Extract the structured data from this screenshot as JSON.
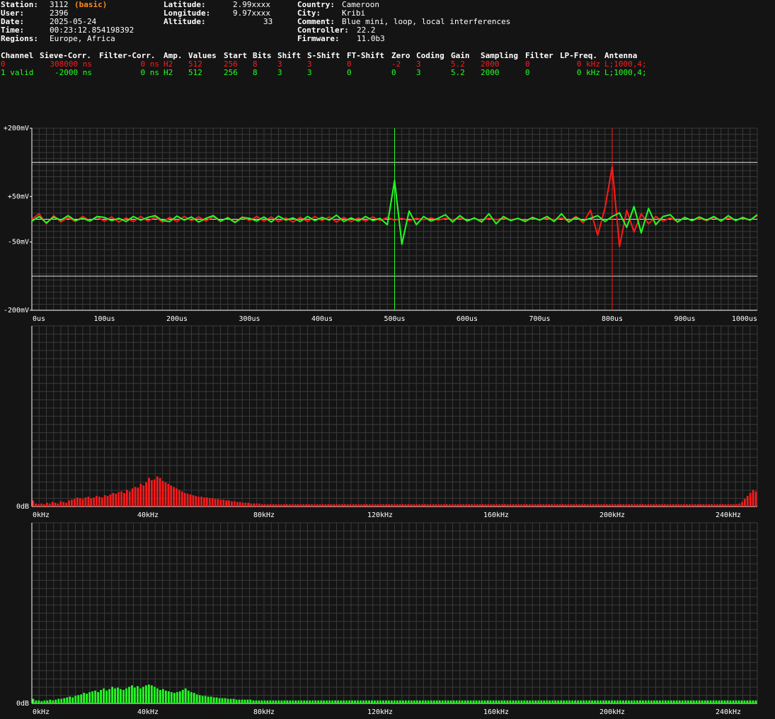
{
  "header": {
    "station_label": "Station:",
    "station": "3112",
    "station_tag": "(basic)",
    "user_label": "User:",
    "user": "2396",
    "date_label": "Date:",
    "date": "2025-05-24",
    "time_label": "Time:",
    "time": "00:23:12.854198392",
    "regions_label": "Regions:",
    "regions": "Europe, Africa",
    "lat_label": "Latitude:",
    "lat": "2.99xxxx",
    "lon_label": "Longitude:",
    "lon": "9.97xxxx",
    "alt_label": "Altitude:",
    "alt": "33",
    "country_label": "Country:",
    "country": "Cameroon",
    "city_label": "City:",
    "city": "Kribi",
    "comment_label": "Comment:",
    "comment": "Blue mini, loop, local interferences",
    "controller_label": "Controller:",
    "controller": "22.2",
    "firmware_label": "Firmware:",
    "firmware": "11.0b3"
  },
  "channel_table": {
    "headers": [
      "Channel",
      "Sieve-Corr.",
      "Filter-Corr.",
      "Amp.",
      "Values",
      "Start",
      "Bits",
      "Shift",
      "S-Shift",
      "FT-Shift",
      "Zero",
      "Coding",
      "Gain",
      "Sampling",
      "Filter",
      "LP-Freq.",
      "Antenna"
    ],
    "rows": [
      [
        "0",
        "308000 ns",
        "0 ns",
        "H2",
        "512",
        "256",
        "8",
        "3",
        "3",
        "0",
        "-2",
        "3",
        "5.2",
        "2000",
        "0",
        "0 kHz",
        "L;1000,4;"
      ],
      [
        "1 valid",
        "-2000 ns",
        "0 ns",
        "H2",
        "512",
        "256",
        "8",
        "3",
        "3",
        "0",
        "0",
        "3",
        "5.2",
        "2000",
        "0",
        "0 kHz",
        "L;1000,4;"
      ]
    ]
  },
  "colors": {
    "background": "#141414",
    "grid": "#3a3a3a",
    "axis": "#ffffff",
    "channel0": "#ff1a1a",
    "channel1": "#22ff22",
    "tag": "#ff8c1a"
  },
  "chart_data": [
    {
      "type": "line",
      "xlim": [
        0,
        1000
      ],
      "ylim": [
        -200,
        200
      ],
      "y_ticks": [
        {
          "value": 200,
          "label": "+200mV"
        },
        {
          "value": 50,
          "label": "+50mV"
        },
        {
          "value": -50,
          "label": "-50mV"
        },
        {
          "value": -200,
          "label": "-200mV"
        }
      ],
      "x_ticks": [
        {
          "value": 0,
          "label": "0us"
        },
        {
          "value": 100,
          "label": "100us"
        },
        {
          "value": 200,
          "label": "200us"
        },
        {
          "value": 300,
          "label": "300us"
        },
        {
          "value": 400,
          "label": "400us"
        },
        {
          "value": 500,
          "label": "500us"
        },
        {
          "value": 600,
          "label": "600us"
        },
        {
          "value": 700,
          "label": "700us"
        },
        {
          "value": 800,
          "label": "800us"
        },
        {
          "value": 900,
          "label": "900us"
        },
        {
          "value": 1000,
          "label": "1000us"
        }
      ],
      "threshold_lines": [
        125,
        -125,
        0
      ],
      "markers": [
        {
          "x": 500,
          "series": 1
        },
        {
          "x": 800,
          "series": 0
        }
      ],
      "series": [
        {
          "channel": "0",
          "color": "#ff1a1a",
          "x": [
            0,
            10,
            20,
            30,
            40,
            50,
            60,
            70,
            80,
            90,
            100,
            110,
            120,
            130,
            140,
            150,
            160,
            170,
            180,
            190,
            200,
            210,
            220,
            230,
            240,
            250,
            260,
            270,
            280,
            290,
            300,
            310,
            320,
            330,
            340,
            350,
            360,
            370,
            380,
            390,
            400,
            410,
            420,
            430,
            440,
            450,
            460,
            470,
            480,
            490,
            500,
            510,
            520,
            530,
            540,
            550,
            560,
            570,
            580,
            590,
            600,
            610,
            620,
            630,
            640,
            650,
            660,
            670,
            680,
            690,
            700,
            710,
            720,
            730,
            740,
            750,
            760,
            770,
            780,
            790,
            800,
            810,
            820,
            830,
            840,
            850,
            860,
            870,
            880,
            890,
            900,
            910,
            920,
            930,
            940,
            950,
            960,
            970,
            980,
            990,
            1000
          ],
          "y": [
            0,
            12,
            -10,
            8,
            -6,
            4,
            -5,
            6,
            -3,
            5,
            -4,
            5,
            -6,
            3,
            -5,
            6,
            -4,
            5,
            -6,
            4,
            -5,
            6,
            -3,
            5,
            -4,
            6,
            -5,
            4,
            -6,
            5,
            -3,
            6,
            -4,
            5,
            -5,
            3,
            -6,
            4,
            -5,
            6,
            -3,
            5,
            -6,
            4,
            -5,
            3,
            -4,
            5,
            -3,
            4,
            -2,
            2,
            -3,
            2,
            -1,
            3,
            -2,
            2,
            -1,
            2,
            -2,
            1,
            -2,
            2,
            -1,
            2,
            -1,
            1,
            -2,
            2,
            -1,
            2,
            -1,
            3,
            -4,
            6,
            -8,
            20,
            -35,
            25,
            115,
            -60,
            20,
            -28,
            12,
            -10,
            6,
            -4,
            3,
            -5,
            4,
            -3,
            2,
            -3,
            4,
            -2,
            3,
            -2,
            2,
            -2,
            8
          ]
        },
        {
          "channel": "1 valid",
          "color": "#22ff22",
          "x": [
            0,
            10,
            20,
            30,
            40,
            50,
            60,
            70,
            80,
            90,
            100,
            110,
            120,
            130,
            140,
            150,
            160,
            170,
            180,
            190,
            200,
            210,
            220,
            230,
            240,
            250,
            260,
            270,
            280,
            290,
            300,
            310,
            320,
            330,
            340,
            350,
            360,
            370,
            380,
            390,
            400,
            410,
            420,
            430,
            440,
            450,
            460,
            470,
            480,
            490,
            500,
            510,
            520,
            530,
            540,
            550,
            560,
            570,
            580,
            590,
            600,
            610,
            620,
            630,
            640,
            650,
            660,
            670,
            680,
            690,
            700,
            710,
            720,
            730,
            740,
            750,
            760,
            770,
            780,
            790,
            800,
            810,
            820,
            830,
            840,
            850,
            860,
            870,
            880,
            890,
            900,
            910,
            920,
            930,
            940,
            950,
            960,
            970,
            980,
            990,
            1000
          ],
          "y": [
            -4,
            6,
            -8,
            5,
            -2,
            8,
            -3,
            2,
            -4,
            6,
            4,
            -3,
            2,
            -5,
            6,
            -2,
            4,
            8,
            -3,
            -5,
            7,
            -2,
            5,
            -6,
            2,
            8,
            -4,
            3,
            -7,
            4,
            2,
            -4,
            5,
            -6,
            7,
            -2,
            3,
            -5,
            6,
            -3,
            4,
            -2,
            9,
            -5,
            3,
            -4,
            6,
            -3,
            2,
            -12,
            85,
            -55,
            18,
            -12,
            6,
            -4,
            2,
            10,
            -6,
            8,
            -4,
            3,
            -6,
            12,
            -10,
            6,
            -3,
            2,
            -5,
            4,
            -2,
            6,
            -5,
            12,
            -6,
            4,
            -3,
            2,
            8,
            -5,
            6,
            14,
            -18,
            28,
            -30,
            24,
            -12,
            6,
            10,
            -6,
            4,
            -3,
            5,
            -2,
            6,
            -4,
            8,
            -3,
            4,
            -2,
            10
          ]
        }
      ]
    },
    {
      "type": "bar",
      "channel": "0",
      "color": "#ff1a1a",
      "ylabel": "0dB",
      "xlim": [
        0,
        250
      ],
      "x_ticks": [
        {
          "value": 0,
          "label": "0kHz"
        },
        {
          "value": 40,
          "label": "40kHz"
        },
        {
          "value": 80,
          "label": "80kHz"
        },
        {
          "value": 120,
          "label": "120kHz"
        },
        {
          "value": 160,
          "label": "160kHz"
        },
        {
          "value": 200,
          "label": "200kHz"
        },
        {
          "value": 240,
          "label": "240kHz"
        }
      ],
      "bin_width_khz": 1.0,
      "values": [
        8,
        4,
        3,
        4,
        3,
        5,
        4,
        6,
        5,
        4,
        7,
        6,
        5,
        8,
        9,
        10,
        12,
        11,
        10,
        12,
        13,
        11,
        12,
        14,
        13,
        12,
        15,
        14,
        16,
        18,
        17,
        19,
        20,
        18,
        22,
        20,
        24,
        26,
        25,
        30,
        28,
        32,
        38,
        35,
        36,
        40,
        38,
        34,
        32,
        30,
        28,
        26,
        24,
        22,
        20,
        18,
        17,
        16,
        15,
        14,
        13,
        13,
        12,
        12,
        11,
        11,
        10,
        10,
        9,
        9,
        8,
        8,
        7,
        7,
        6,
        6,
        5,
        5,
        5,
        4,
        4,
        4,
        4,
        3,
        3,
        3,
        3,
        3,
        3,
        3,
        3,
        3,
        3,
        3,
        3,
        3,
        3,
        3,
        3,
        3,
        3,
        3,
        3,
        3,
        3,
        3,
        3,
        3,
        3,
        3,
        3,
        3,
        3,
        3,
        3,
        3,
        3,
        3,
        3,
        3,
        3,
        3,
        3,
        3,
        3,
        3,
        3,
        3,
        3,
        3,
        3,
        3,
        3,
        3,
        3,
        3,
        3,
        3,
        3,
        3,
        3,
        3,
        3,
        3,
        3,
        3,
        3,
        3,
        3,
        3,
        3,
        3,
        3,
        3,
        3,
        3,
        3,
        3,
        3,
        3,
        3,
        3,
        3,
        3,
        3,
        3,
        3,
        3,
        3,
        3,
        3,
        3,
        3,
        3,
        3,
        3,
        3,
        3,
        3,
        3,
        3,
        3,
        3,
        3,
        3,
        3,
        3,
        3,
        3,
        3,
        3,
        3,
        3,
        3,
        3,
        3,
        3,
        3,
        3,
        3,
        3,
        3,
        3,
        3,
        3,
        3,
        3,
        3,
        3,
        3,
        3,
        3,
        3,
        3,
        3,
        3,
        3,
        3,
        3,
        3,
        3,
        3,
        3,
        3,
        3,
        3,
        3,
        3,
        3,
        3,
        3,
        3,
        3,
        3,
        3,
        3,
        3,
        3,
        3,
        3,
        3,
        3,
        3,
        3,
        3,
        3,
        3,
        3,
        3,
        3,
        3,
        3,
        3,
        3,
        3,
        3,
        4,
        6,
        10,
        14,
        18,
        22,
        20
      ],
      "ylim": [
        0,
        240
      ]
    },
    {
      "type": "bar",
      "channel": "1 valid",
      "color": "#22ff22",
      "ylabel": "0dB",
      "xlim": [
        0,
        250
      ],
      "x_ticks": [
        {
          "value": 0,
          "label": "0kHz"
        },
        {
          "value": 40,
          "label": "40kHz"
        },
        {
          "value": 80,
          "label": "80kHz"
        },
        {
          "value": 120,
          "label": "120kHz"
        },
        {
          "value": 160,
          "label": "160kHz"
        },
        {
          "value": 200,
          "label": "200kHz"
        },
        {
          "value": 240,
          "label": "240kHz"
        }
      ],
      "bin_width_khz": 1.0,
      "values": [
        6,
        4,
        4,
        3,
        4,
        4,
        5,
        4,
        5,
        6,
        6,
        7,
        8,
        9,
        8,
        10,
        11,
        12,
        14,
        13,
        15,
        16,
        17,
        15,
        18,
        20,
        17,
        19,
        22,
        20,
        21,
        19,
        18,
        20,
        22,
        24,
        21,
        23,
        20,
        22,
        24,
        25,
        24,
        22,
        20,
        18,
        19,
        17,
        16,
        15,
        14,
        15,
        16,
        18,
        20,
        17,
        15,
        14,
        12,
        11,
        10,
        10,
        9,
        9,
        8,
        8,
        7,
        7,
        7,
        6,
        6,
        6,
        5,
        5,
        5,
        5,
        5,
        5,
        4,
        4,
        4,
        4,
        4,
        4,
        4,
        4,
        4,
        4,
        4,
        4,
        4,
        4,
        4,
        4,
        4,
        4,
        4,
        4,
        4,
        4,
        4,
        4,
        4,
        4,
        4,
        4,
        4,
        4,
        4,
        4,
        4,
        4,
        4,
        4,
        4,
        4,
        4,
        4,
        4,
        4,
        4,
        4,
        4,
        4,
        4,
        4,
        4,
        4,
        4,
        4,
        4,
        4,
        4,
        4,
        4,
        4,
        4,
        4,
        4,
        4,
        4,
        4,
        4,
        4,
        4,
        4,
        4,
        4,
        4,
        4,
        4,
        4,
        4,
        4,
        4,
        4,
        4,
        4,
        4,
        4,
        4,
        4,
        4,
        4,
        4,
        4,
        4,
        4,
        4,
        4,
        4,
        4,
        4,
        4,
        4,
        4,
        4,
        4,
        4,
        4,
        4,
        4,
        4,
        4,
        4,
        4,
        4,
        4,
        4,
        4,
        4,
        4,
        4,
        4,
        4,
        4,
        4,
        4,
        4,
        4,
        4,
        4,
        4,
        4,
        4,
        4,
        4,
        4,
        4,
        4,
        4,
        4,
        4,
        4,
        4,
        4,
        4,
        4,
        4,
        4,
        4,
        4,
        4,
        4,
        4,
        4,
        4,
        4,
        4,
        4,
        4,
        4,
        4,
        4,
        4,
        4,
        4,
        4,
        4,
        4,
        4,
        4,
        4,
        4,
        4,
        4,
        4,
        4,
        4,
        4,
        4,
        4,
        4,
        4,
        4,
        4,
        4
      ],
      "ylim": [
        0,
        240
      ]
    }
  ]
}
